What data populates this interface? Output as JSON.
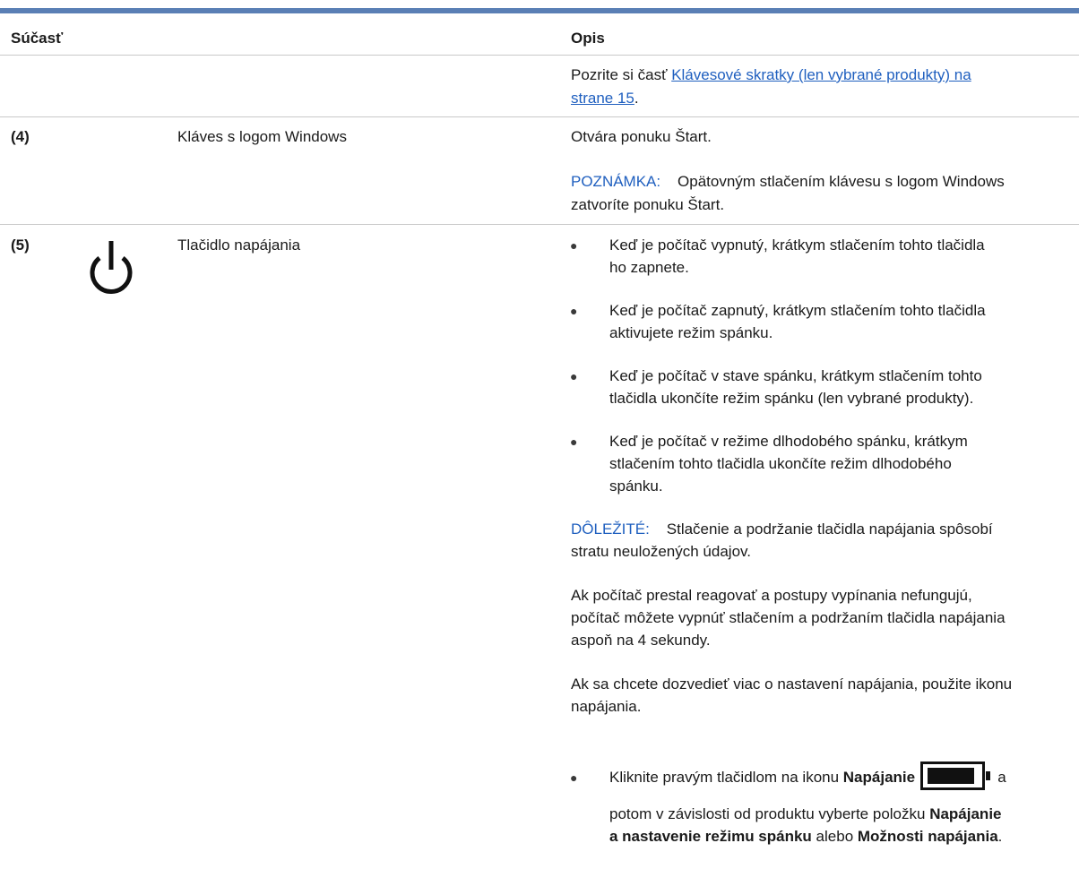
{
  "header": {
    "col1": "Súčasť",
    "col2": "Opis"
  },
  "row_prev": {
    "text_prefix": "Pozrite si časť ",
    "link_line1": "Klávesové skratky (len vybrané produkty) na",
    "link_line2": "strane 15",
    "text_suffix": "."
  },
  "row4": {
    "number": "(4)",
    "component": "Kláves s logom Windows",
    "description": "Otvára ponuku Štart.",
    "note_label": "POZNÁMKA:",
    "note_line1": "Opätovným stlačením klávesu s logom Windows",
    "note_line2": "zatvoríte ponuku Štart."
  },
  "row5": {
    "number": "(5)",
    "icon": "power-icon",
    "component": "Tlačidlo napájania",
    "bullets": [
      {
        "l1": "Keď je počítač vypnutý, krátkym stlačením tohto tlačidla",
        "l2": "ho zapnete.",
        "l3": ""
      },
      {
        "l1": "Keď je počítač zapnutý, krátkym stlačením tohto tlačidla",
        "l2": "aktivujete režim spánku.",
        "l3": ""
      },
      {
        "l1": "Keď je počítač v stave spánku, krátkym stlačením tohto",
        "l2": "tlačidla ukončíte režim spánku (len vybrané produkty).",
        "l3": ""
      },
      {
        "l1": "Keď je počítač v režime dlhodobého spánku, krátkym",
        "l2": "stlačením tohto tlačidla ukončíte režim dlhodobého",
        "l3": "spánku."
      }
    ],
    "important_label": "DÔLEŽITÉ:",
    "important_line1": "Stlačenie a podržanie tlačidla napájania spôsobí",
    "important_line2": "stratu neuložených údajov.",
    "para1_l1": "Ak počítač prestal reagovať a postupy vypínania nefungujú,",
    "para1_l2": "počítač môžete vypnúť stlačením a podržaním tlačidla napájania",
    "para1_l3": "aspoň na 4 sekundy.",
    "para2_l1": "Ak sa chcete dozvedieť viac o nastavení napájania, použite ikonu",
    "para2_l2": "napájania.",
    "last_bullet": {
      "prefix": "Kliknite pravým tlačidlom na ikonu ",
      "bold1": "Napájanie",
      "battery_icon": "battery-icon",
      "after_icon": "a",
      "line2_prefix": "potom v závislosti od produktu vyberte položku ",
      "bold2a": "Napájanie",
      "bold2b": "a nastavenie režimu spánku",
      "middle": " alebo ",
      "bold3": "Možnosti napájania",
      "end": "."
    }
  }
}
